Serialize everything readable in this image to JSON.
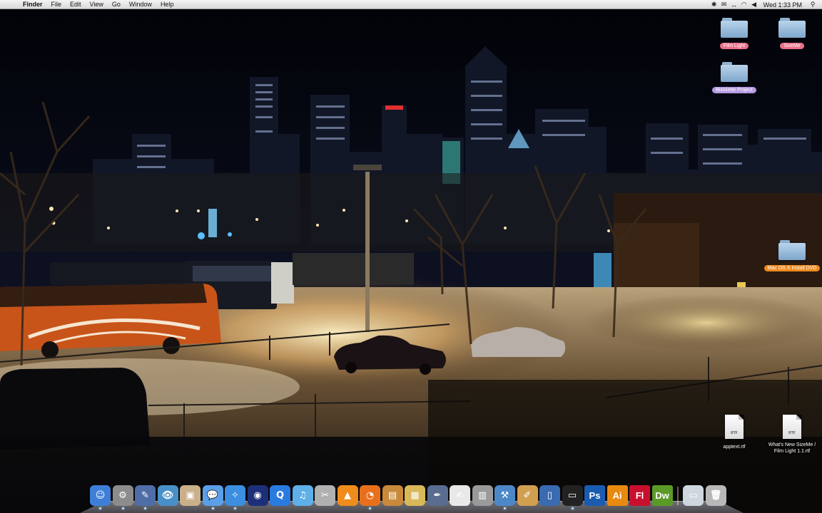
{
  "menubar": {
    "apple_icon": "apple-logo-icon",
    "app_name": "Finder",
    "menus": [
      "File",
      "Edit",
      "View",
      "Go",
      "Window",
      "Help"
    ],
    "status_icons": [
      "script-menu-icon",
      "mail-icon",
      "sync-icon",
      "wifi-icon",
      "volume-icon"
    ],
    "clock": "Wed 1:33 PM",
    "spotlight_icon": "spotlight-search-icon"
  },
  "desktop": {
    "icons": [
      {
        "label": "Film Light",
        "type": "folder",
        "label_color": "#e9708a"
      },
      {
        "label": "SizeMe",
        "type": "folder",
        "label_color": "#e9708a"
      },
      {
        "label": "Bixiclette Project",
        "type": "folder",
        "label_color": "#b49ae0"
      },
      {
        "label": "Mac OS X Install DVD",
        "type": "disk",
        "label_color": "#ee8a20"
      },
      {
        "label": "apptext.rtf",
        "type": "rtf-document"
      },
      {
        "label": "What's New SizeMe / Film Light 1.1.rtf",
        "type": "rtf-document"
      }
    ],
    "rtf_badge": "RTF",
    "wallpaper": "montreal-night-skyline-snow-parking-lot"
  },
  "dock": {
    "apps": [
      {
        "name": "finder-icon",
        "glyph": "☺",
        "bg": "#3d7fd8"
      },
      {
        "name": "system-preferences-icon",
        "glyph": "⚙",
        "bg": "#8c8c8c"
      },
      {
        "name": "automator-icon",
        "glyph": "✎",
        "bg": "#4f6ea8"
      },
      {
        "name": "preview-icon",
        "glyph": "👁",
        "bg": "#4a90c8"
      },
      {
        "name": "iphoto-icon",
        "glyph": "▣",
        "bg": "#c9b08a"
      },
      {
        "name": "ichat-icon",
        "glyph": "💬",
        "bg": "#5aa0e8"
      },
      {
        "name": "safari-icon",
        "glyph": "✧",
        "bg": "#3b8ee0"
      },
      {
        "name": "quicktime-icon",
        "glyph": "◉",
        "bg": "#1e2f7a"
      },
      {
        "name": "quicktime-player-icon",
        "glyph": "Q",
        "bg": "#2a7be0"
      },
      {
        "name": "itunes-icon",
        "glyph": "♫",
        "bg": "#5fb0e8"
      },
      {
        "name": "dvd-player-icon",
        "glyph": "✂",
        "bg": "#b0b0b0"
      },
      {
        "name": "vlc-icon",
        "glyph": "▲",
        "bg": "#f08c1c"
      },
      {
        "name": "firefox-icon",
        "glyph": "◔",
        "bg": "#e8701c"
      },
      {
        "name": "photo-booth-icon",
        "glyph": "▤",
        "bg": "#c88a3a"
      },
      {
        "name": "archive-utility-icon",
        "glyph": "▦",
        "bg": "#d8b858"
      },
      {
        "name": "script-editor-icon",
        "glyph": "✒",
        "bg": "#5a6c90"
      },
      {
        "name": "textedit-icon",
        "glyph": "✍",
        "bg": "#e8e8e8"
      },
      {
        "name": "calculator-icon",
        "glyph": "▥",
        "bg": "#9a9a9a"
      },
      {
        "name": "xcode-icon",
        "glyph": "⚒",
        "bg": "#4c88c8"
      },
      {
        "name": "interface-builder-icon",
        "glyph": "✐",
        "bg": "#d0a050"
      },
      {
        "name": "iphone-simulator-icon",
        "glyph": "▯",
        "bg": "#3a6ab0"
      },
      {
        "name": "terminal-icon",
        "glyph": "▭",
        "bg": "#222222"
      },
      {
        "name": "photoshop-icon",
        "glyph": "Ps",
        "bg": "#1a5cb0"
      },
      {
        "name": "illustrator-icon",
        "glyph": "Ai",
        "bg": "#e88a10"
      },
      {
        "name": "flash-icon",
        "glyph": "Fl",
        "bg": "#c8102e"
      },
      {
        "name": "dreamweaver-icon",
        "glyph": "Dw",
        "bg": "#5c9a28"
      }
    ],
    "right": [
      {
        "name": "downloads-stack-icon",
        "glyph": "▭",
        "bg": "#cfd6de"
      },
      {
        "name": "trash-icon",
        "glyph": "🗑",
        "bg": "#b8b8b8"
      }
    ]
  }
}
